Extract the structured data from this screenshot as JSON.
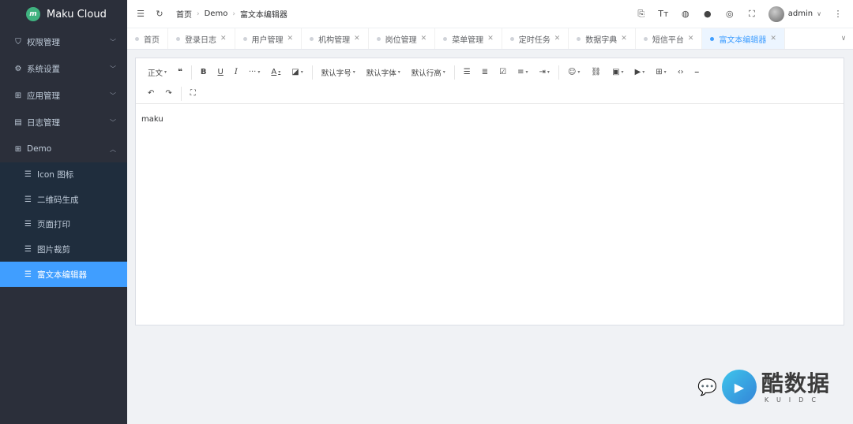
{
  "app": {
    "name": "Maku Cloud",
    "logo_mark": "m"
  },
  "sidebar": {
    "items": [
      {
        "label": "权限管理",
        "icon": "shield-icon",
        "glyph": "⛉",
        "expanded": false
      },
      {
        "label": "系统设置",
        "icon": "gear-icon",
        "glyph": "⚙",
        "expanded": false
      },
      {
        "label": "应用管理",
        "icon": "grid-icon",
        "glyph": "⊞",
        "expanded": false
      },
      {
        "label": "日志管理",
        "icon": "log-icon",
        "glyph": "▤",
        "expanded": false
      },
      {
        "label": "Demo",
        "icon": "apps-icon",
        "glyph": "⊞",
        "expanded": true
      }
    ],
    "demo_children": [
      {
        "label": "Icon 图标",
        "active": false
      },
      {
        "label": "二维码生成",
        "active": false
      },
      {
        "label": "页面打印",
        "active": false
      },
      {
        "label": "图片裁剪",
        "active": false
      },
      {
        "label": "富文本编辑器",
        "active": true
      }
    ]
  },
  "header": {
    "breadcrumb": [
      "首页",
      "Demo",
      "富文本编辑器"
    ],
    "user": "admin"
  },
  "tabs": [
    {
      "label": "首页",
      "closable": false,
      "active": false
    },
    {
      "label": "登录日志",
      "closable": true,
      "active": false
    },
    {
      "label": "用户管理",
      "closable": true,
      "active": false
    },
    {
      "label": "机构管理",
      "closable": true,
      "active": false
    },
    {
      "label": "岗位管理",
      "closable": true,
      "active": false
    },
    {
      "label": "菜单管理",
      "closable": true,
      "active": false
    },
    {
      "label": "定时任务",
      "closable": true,
      "active": false
    },
    {
      "label": "数据字典",
      "closable": true,
      "active": false
    },
    {
      "label": "短信平台",
      "closable": true,
      "active": false
    },
    {
      "label": "富文本编辑器",
      "closable": true,
      "active": true
    }
  ],
  "toolbar": {
    "paragraph": "正文",
    "font_size": "默认字号",
    "font_family": "默认字体",
    "line_height": "默认行高"
  },
  "editor": {
    "content": "maku"
  },
  "watermark": {
    "title": "酷数据",
    "subtitle": "KUIDC"
  },
  "colors": {
    "sidebar_bg": "#2b2f3a",
    "accent": "#409eff"
  }
}
